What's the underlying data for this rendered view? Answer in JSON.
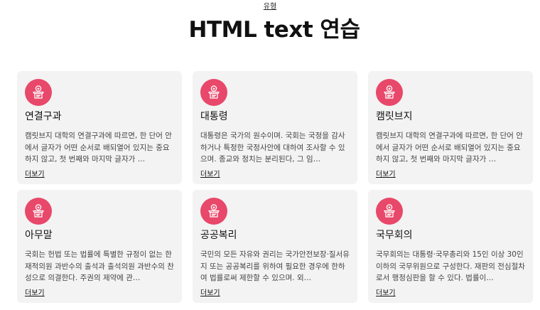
{
  "header": {
    "eyebrow": "유형",
    "title": "HTML text 연습"
  },
  "theme": {
    "accent": "#e8486a",
    "card_bg": "#f3f3f3"
  },
  "cards": [
    {
      "icon": "podium-icon",
      "title": "연결구과",
      "desc": "캠릿브지 대학의 연결구과에 따르면, 한 단어 안에서 글자가 어떤 순서로 배되열어 있지는 중요하지 않고, 첫 번째와 마지막 글자가 …",
      "more": "더보기"
    },
    {
      "icon": "podium-icon",
      "title": "대통령",
      "desc": "대통령은 국가의 원수이며. 국회는 국정을 감사하거나 특정한 국정사안에 대하여 조사할 수 있으며. 종교와 정치는 분리된다, 그 임…",
      "more": "더보기"
    },
    {
      "icon": "podium-icon",
      "title": "캠릿브지",
      "desc": "캠릿브지 대학의 연결구과에 따르면, 한 단어 안에서 글자가 어떤 순서로 배되열어 있지는 중요하지 않고, 첫 번째와 마지막 글자가 …",
      "more": "더보기"
    },
    {
      "icon": "podium-icon",
      "title": "아무말",
      "desc": "국회는 헌법 또는 법률에 특별한 규정이 없는 한 재적의원 과반수의 출석과 출석의원 과반수의 찬성으로 의결한다. 주권의 제약에 관…",
      "more": "더보기"
    },
    {
      "icon": "podium-icon",
      "title": "공공복리",
      "desc": "국민의 모든 자유와 권리는 국가안전보장·질서유지 또는 공공복리를 위하여 필요한 경우에 한하여 법률로써 제한할 수 있으며. 외…",
      "more": "더보기"
    },
    {
      "icon": "podium-icon",
      "title": "국무회의",
      "desc": "국무회의는 대통령·국무총리와 15인 이상 30인 이하의 국무위원으로 구성한다. 재판의 전심절차로서 행정심판을 할 수 있다. 법률이…",
      "more": "더보기"
    }
  ]
}
